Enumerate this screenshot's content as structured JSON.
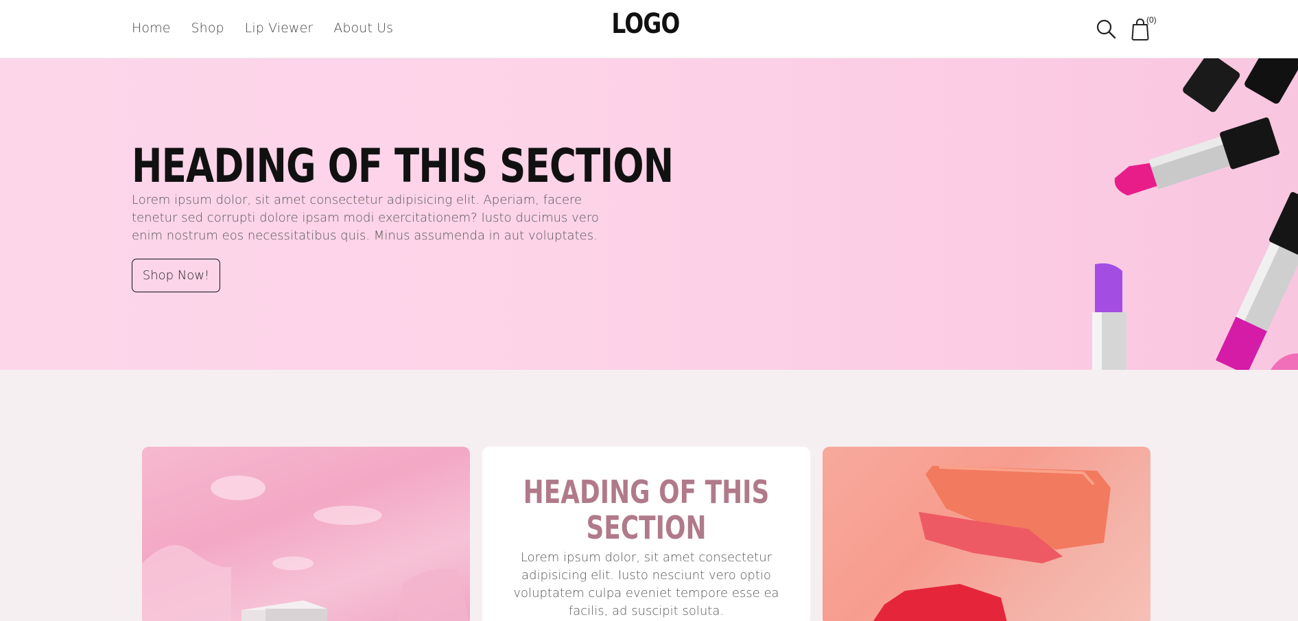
{
  "header": {
    "nav": [
      {
        "label": "Home"
      },
      {
        "label": "Shop"
      },
      {
        "label": "Lip Viewer"
      },
      {
        "label": "About Us"
      }
    ],
    "logo": "LOGO",
    "search_icon": "search-icon",
    "cart_icon": "shopping-bag-icon",
    "cart_count": "(0)"
  },
  "hero": {
    "title": "HEADING OF THIS SECTION",
    "text": "Lorem ipsum dolor, sit amet consectetur adipisicing elit. Aperiam, facere tenetur sed corrupti dolore ipsam modi exercitationem? Iusto ducimus vero enim nostrum eos necessitatibus quis. Minus assumenda in aut voluptates.",
    "button": "Shop Now!",
    "bg_color": "#fdd6ea"
  },
  "section": {
    "card_title": "HEADING OF THIS SECTION",
    "card_text": "Lorem ipsum dolor, sit amet consectetur adipisicing elit. Iusto nesciunt vero optio voluptatem culpa eveniet tempore esse ea facilis, ad suscipit soluta.",
    "title_color": "#b07a8a"
  }
}
